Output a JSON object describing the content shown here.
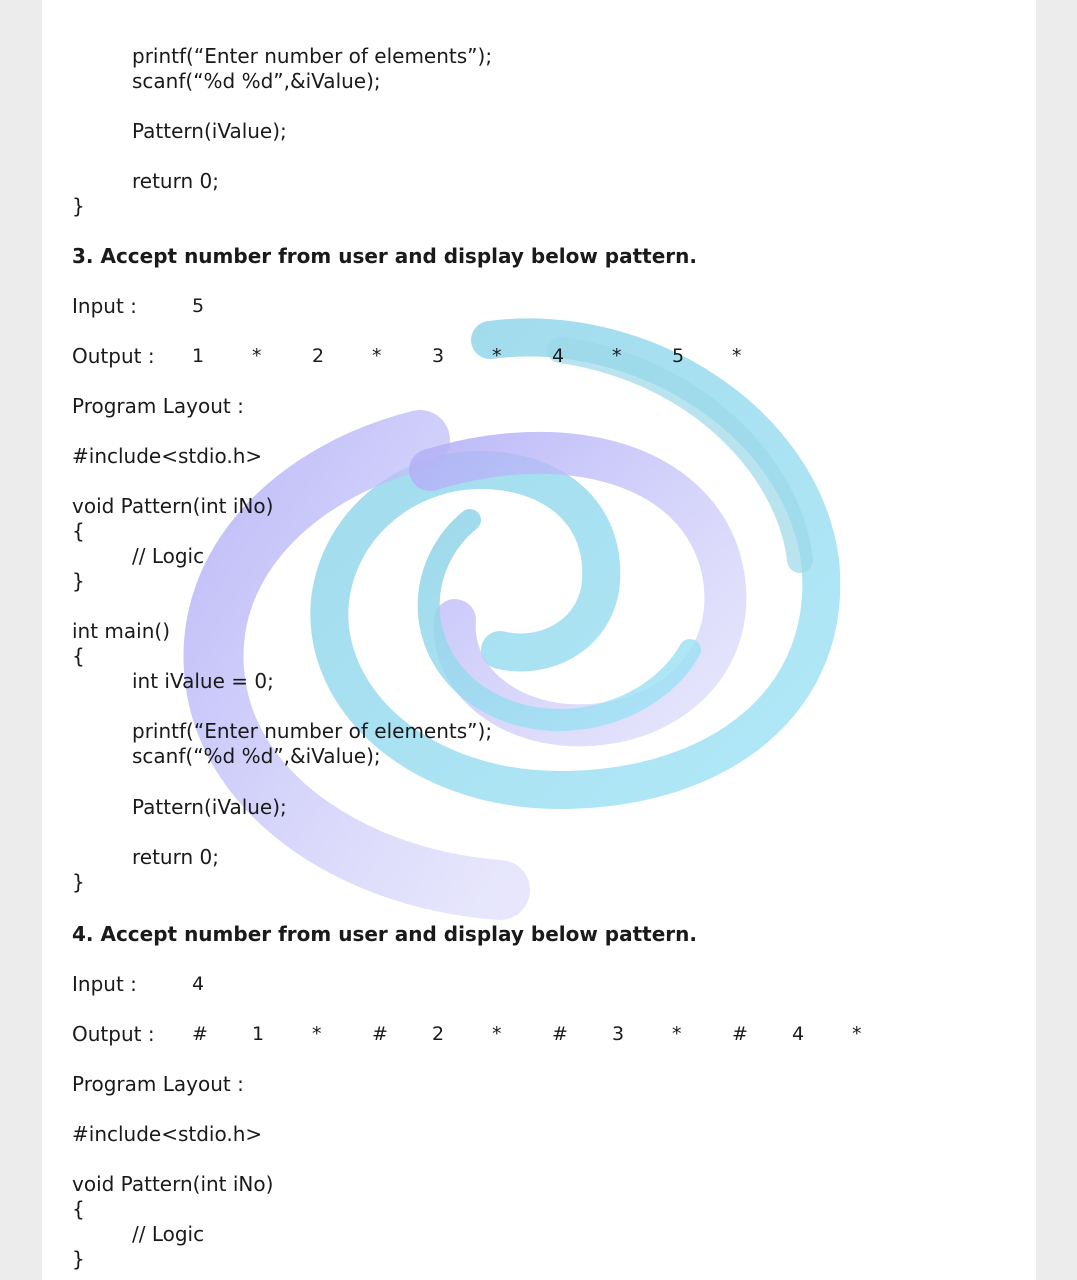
{
  "block1": {
    "printf_line": "printf(“Enter number of elements”);",
    "scanf_line": "scanf(“%d %d”,&iValue);",
    "pattern_call": "Pattern(iValue);",
    "return_line": "return 0;",
    "close_brace": "}"
  },
  "q3": {
    "heading": "3. Accept number from user and display below pattern.",
    "input_label": "Input :",
    "input_value": "5",
    "output_label": "Output :",
    "output_tokens": [
      "1",
      "*",
      "2",
      "*",
      "3",
      "*",
      "4",
      "*",
      "5",
      "*"
    ],
    "layout_label": "Program Layout :",
    "include_line": "#include<stdio.h>",
    "func_sig": "void Pattern(int iNo)",
    "open_brace": "{",
    "logic_comment": "// Logic",
    "close_brace": "}",
    "main_sig": "int main()",
    "main_open": "{",
    "decl_line": "int iValue = 0;",
    "printf_line": "printf(“Enter number of elements”);",
    "scanf_line": "scanf(“%d %d”,&iValue);",
    "pattern_call": "Pattern(iValue);",
    "return_line": "return 0;",
    "main_close": "}"
  },
  "q4": {
    "heading": "4. Accept number from user and display below pattern.",
    "input_label": "Input :",
    "input_value": "4",
    "output_label": "Output :",
    "output_tokens": [
      "#",
      "1",
      "*",
      "#",
      "2",
      "*",
      "#",
      "3",
      "*",
      "#",
      "4",
      "*"
    ],
    "layout_label": "Program Layout :",
    "include_line": "#include<stdio.h>",
    "func_sig": "void Pattern(int iNo)",
    "open_brace": "{",
    "logic_comment": "// Logic",
    "close_brace": "}"
  },
  "colors": {
    "page": "#ffffff",
    "background": "#ececec",
    "swirl_purple": "#a9a6f5",
    "swirl_cyan": "#8ad6ef"
  }
}
